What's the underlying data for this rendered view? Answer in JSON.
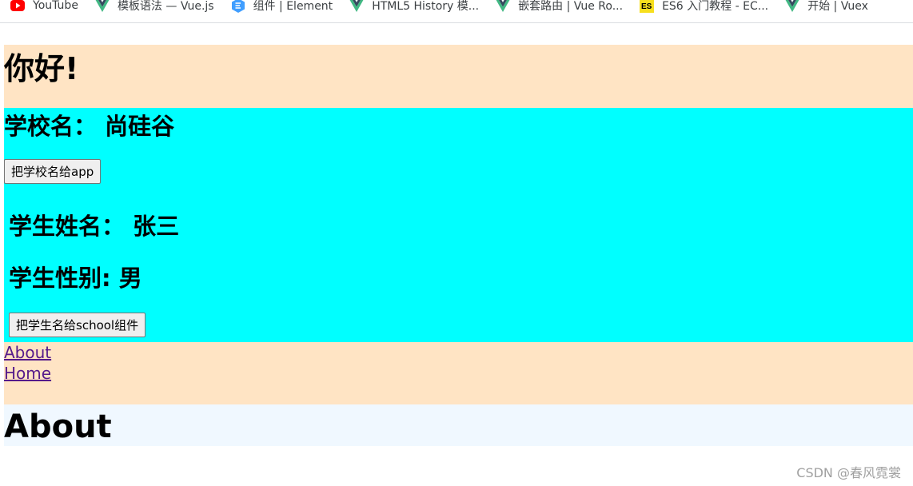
{
  "bookmarks": [
    {
      "label": "YouTube",
      "icon": "youtube-icon"
    },
    {
      "label": "模板语法 — Vue.js",
      "icon": "vue-icon"
    },
    {
      "label": "组件 | Element",
      "icon": "element-icon"
    },
    {
      "label": "HTML5 History 模...",
      "icon": "vue-icon"
    },
    {
      "label": "嵌套路由 | Vue Ro...",
      "icon": "vue-icon"
    },
    {
      "label": "ES6 入门教程 - EC...",
      "icon": "es6-icon"
    },
    {
      "label": "开始 | Vuex",
      "icon": "vue-icon"
    }
  ],
  "app": {
    "title": "你好!",
    "header_bg": "#ffe4c4"
  },
  "school": {
    "name_line": "学校名： 尚硅谷",
    "button_label": "把学校名给app",
    "bg": "#00ffff"
  },
  "student": {
    "name_line": "学生姓名： 张三",
    "sex_line": "学生性别: 男",
    "button_label": "把学生名给school组件"
  },
  "nav": {
    "links": [
      "About",
      "Home"
    ],
    "bg": "#ffe4c4"
  },
  "router_view": {
    "title": "About",
    "bg": "#f0f8ff"
  },
  "watermark": "CSDN @春风霓裳",
  "colors": {
    "link": "#551a8b",
    "youtube_red": "#ff0000",
    "vue_green": "#41b883",
    "vue_dark": "#35495e",
    "es6_yellow": "#f7df1e",
    "element_blue": "#409eff"
  }
}
